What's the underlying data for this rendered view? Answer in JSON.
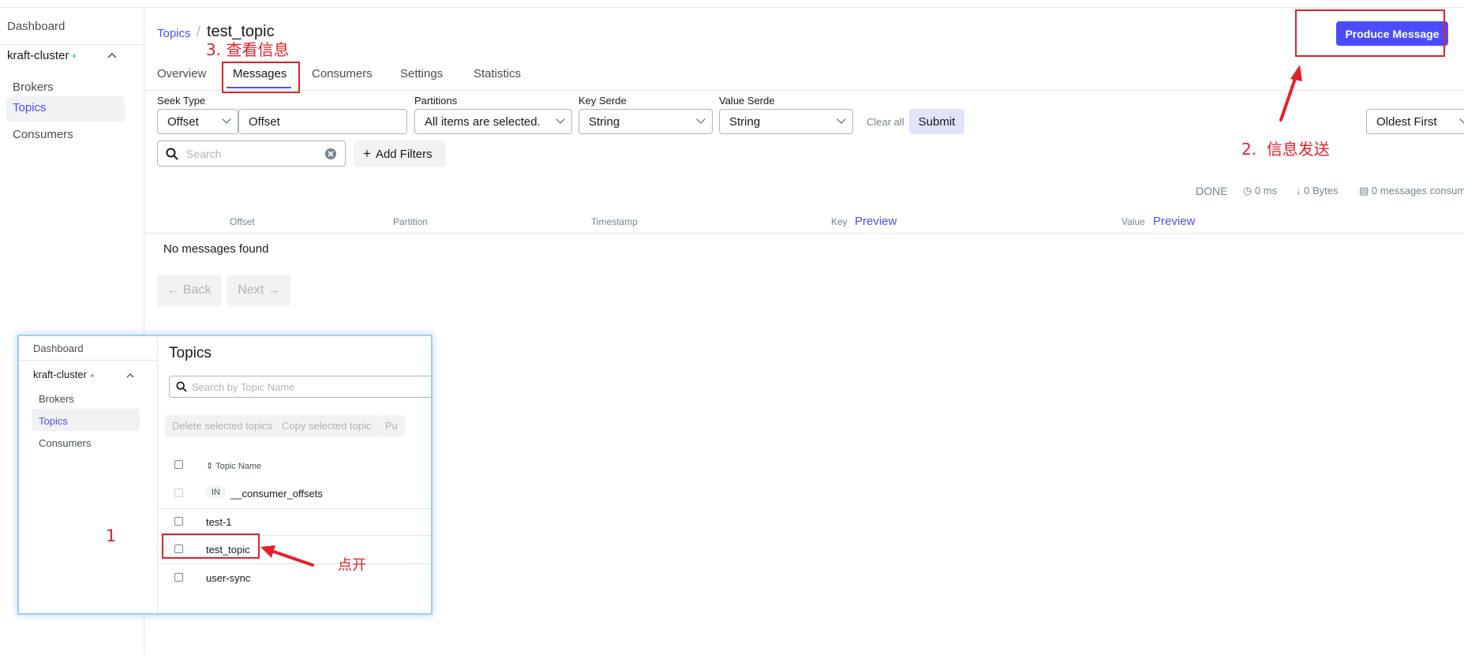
{
  "sidebar": {
    "dashboard": "Dashboard",
    "cluster": "kraft-cluster",
    "items": [
      {
        "label": "Brokers"
      },
      {
        "label": "Topics"
      },
      {
        "label": "Consumers"
      }
    ]
  },
  "header": {
    "breadcrumb_link": "Topics",
    "separator": "/",
    "title": "test_topic",
    "produce_button": "Produce Message"
  },
  "tabs": [
    {
      "label": "Overview"
    },
    {
      "label": "Messages"
    },
    {
      "label": "Consumers"
    },
    {
      "label": "Settings"
    },
    {
      "label": "Statistics"
    }
  ],
  "filters": {
    "seek_type_label": "Seek Type",
    "seek_type_value": "Offset",
    "offset_value": "Offset",
    "partitions_label": "Partitions",
    "partitions_value": "All items are selected.",
    "key_serde_label": "Key Serde",
    "key_serde_value": "String",
    "value_serde_label": "Value Serde",
    "value_serde_value": "String",
    "clear_all": "Clear all",
    "submit": "Submit",
    "sort_value": "Oldest First",
    "search_placeholder": "Search",
    "add_filters": "Add Filters"
  },
  "stats": {
    "status": "DONE",
    "time": "0 ms",
    "bytes": "0 Bytes",
    "consumed": "0 messages consum"
  },
  "table": {
    "columns": [
      "Offset",
      "Partition",
      "Timestamp",
      "Key",
      "Value"
    ],
    "preview": "Preview",
    "empty": "No messages found"
  },
  "pagination": {
    "back": "← Back",
    "next": "Next →"
  },
  "inset": {
    "dashboard": "Dashboard",
    "cluster": "kraft-cluster",
    "items": [
      "Brokers",
      "Topics",
      "Consumers"
    ],
    "title": "Topics",
    "search_placeholder": "Search by Topic Name",
    "buttons": [
      "Delete selected topics",
      "Copy selected topic",
      "Pu"
    ],
    "column": "Topic Name",
    "internal_badge": "IN",
    "topics": [
      "__consumer_offsets",
      "test-1",
      "test_topic",
      "user-sync"
    ]
  },
  "annotations": {
    "step1": "1",
    "step1_note": "点开",
    "step2_num": "2.",
    "step2_text": "信息发送",
    "step3_num": "3.",
    "step3_text": "查看信息"
  },
  "colors": {
    "accent": "#4c4cff",
    "annotation_red": "#e3212a",
    "status_dot": "#5cd685"
  }
}
